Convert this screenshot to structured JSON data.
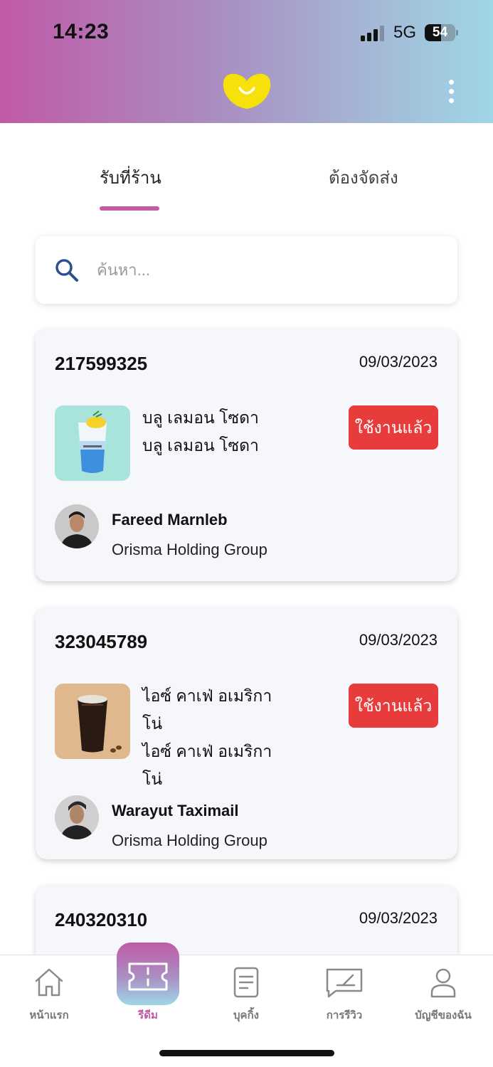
{
  "status_bar": {
    "time": "14:23",
    "network": "5G",
    "battery": "54",
    "battery_level": 0.54
  },
  "header": {
    "logo_icon": "smile-heart-logo",
    "menu_icon": "kebab-menu-icon"
  },
  "tabs": [
    {
      "label": "รับที่ร้าน",
      "active": true
    },
    {
      "label": "ต้องจัดส่ง",
      "active": false
    }
  ],
  "search": {
    "placeholder": "ค้นหา..."
  },
  "orders": [
    {
      "order_no": "217599325",
      "date": "09/03/2023",
      "product_name_line1": "บลู เลมอน โซดา",
      "product_name_line2": "บลู เลมอน โซดา",
      "status_label": "ใช้งานแล้ว",
      "user_name": "Fareed Marnleb",
      "organization": "Orisma Holding Group"
    },
    {
      "order_no": "323045789",
      "date": "09/03/2023",
      "product_name_line1": "ไอซ์ คาเฟ่ อเมริกาโน่",
      "product_name_line2": "ไอซ์ คาเฟ่ อเมริกาโน่",
      "status_label": "ใช้งานแล้ว",
      "user_name": "Warayut Taximail",
      "organization": "Orisma Holding Group"
    },
    {
      "order_no": "240320310",
      "date": "09/03/2023"
    }
  ],
  "bottom_nav": [
    {
      "label": "หน้าแรก",
      "icon": "home-icon",
      "active": false
    },
    {
      "label": "รีดีม",
      "icon": "ticket-icon",
      "active": true
    },
    {
      "label": "บุคกิ้ง",
      "icon": "document-icon",
      "active": false
    },
    {
      "label": "การรีวิว",
      "icon": "review-icon",
      "active": false
    },
    {
      "label": "บัญชีของฉัน",
      "icon": "user-icon",
      "active": false
    }
  ],
  "colors": {
    "accent": "#c45aa3",
    "used_button": "#e83b3b",
    "search_icon": "#2c4f8f"
  }
}
